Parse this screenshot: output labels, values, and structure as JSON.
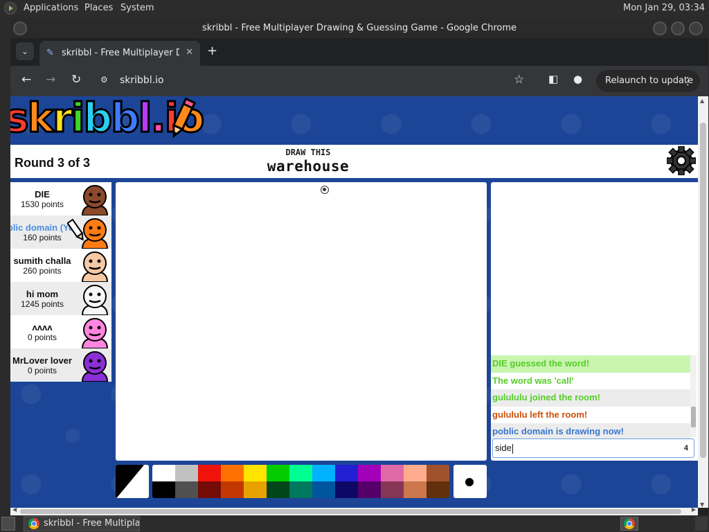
{
  "os": {
    "menu": [
      "Applications",
      "Places",
      "System"
    ],
    "clock": "Mon Jan 29, 03:34"
  },
  "browser": {
    "window_title": "skribbl - Free Multiplayer Drawing & Guessing Game - Google Chrome",
    "tab_title": "skribbl - Free Multiplayer Drawing & Guessing Game",
    "url": "skribbl.io",
    "relaunch_label": "Relaunch to update"
  },
  "game": {
    "logo_letters": [
      "s",
      "k",
      "r",
      "i",
      "b",
      "b",
      "l",
      ".",
      "i",
      "o"
    ],
    "logo_colors": [
      "#ff3b2f",
      "#ff8a1c",
      "#ffe11c",
      "#3fd72a",
      "#29cff2",
      "#3d7bff",
      "#b63df5",
      "#ff4fb0",
      "#ff3b2f",
      "#ff8a1c"
    ],
    "round": "Round 3 of 3",
    "draw_label": "DRAW THIS",
    "word": "warehouse"
  },
  "players": [
    {
      "name": "DIE",
      "points": "1530 points",
      "avatar_color": "#8b4a2a",
      "drawing": false,
      "you": false
    },
    {
      "name": "poblic domain (You)",
      "points": "160 points",
      "avatar_color": "#ff7b14",
      "drawing": true,
      "you": true
    },
    {
      "name": "sumith challa",
      "points": "260 points",
      "avatar_color": "#f6c9a6",
      "drawing": false,
      "you": false
    },
    {
      "name": "hi mom",
      "points": "1245 points",
      "avatar_color": "#f7f7f7",
      "drawing": false,
      "you": false
    },
    {
      "name": "ʌʌʌʌ",
      "points": "0 points",
      "avatar_color": "#ff86e0",
      "drawing": false,
      "you": false
    },
    {
      "name": "MrLover lover",
      "points": "0 points",
      "avatar_color": "#8a2fd6",
      "drawing": false,
      "you": false
    }
  ],
  "chat": {
    "messages": [
      {
        "text": "DIE guessed the word!",
        "style": "guessed"
      },
      {
        "text": "The word was 'call'",
        "style": "green"
      },
      {
        "text": "gulululu joined the room!",
        "style": "green shade"
      },
      {
        "text": "gulululu left the room!",
        "style": "orange"
      },
      {
        "text": "poblic domain is drawing now!",
        "style": "blue shade"
      }
    ],
    "input_value": "side",
    "char_count": "4"
  },
  "palette": [
    "#ffffff",
    "#c1c1c1",
    "#ef130b",
    "#ff7100",
    "#ffe400",
    "#00cc00",
    "#00ff91",
    "#00b2ff",
    "#231fd3",
    "#a300ba",
    "#df69a7",
    "#ffac8e",
    "#a0522d",
    "#000000",
    "#505050",
    "#740b07",
    "#c23800",
    "#e8a200",
    "#004619",
    "#00785d",
    "#00569e",
    "#0e0865",
    "#550069",
    "#873554",
    "#cc774d",
    "#63300d"
  ],
  "taskbar": {
    "window_label": "skribbl - Free Multiplayer Drawing & Guessing Game"
  }
}
